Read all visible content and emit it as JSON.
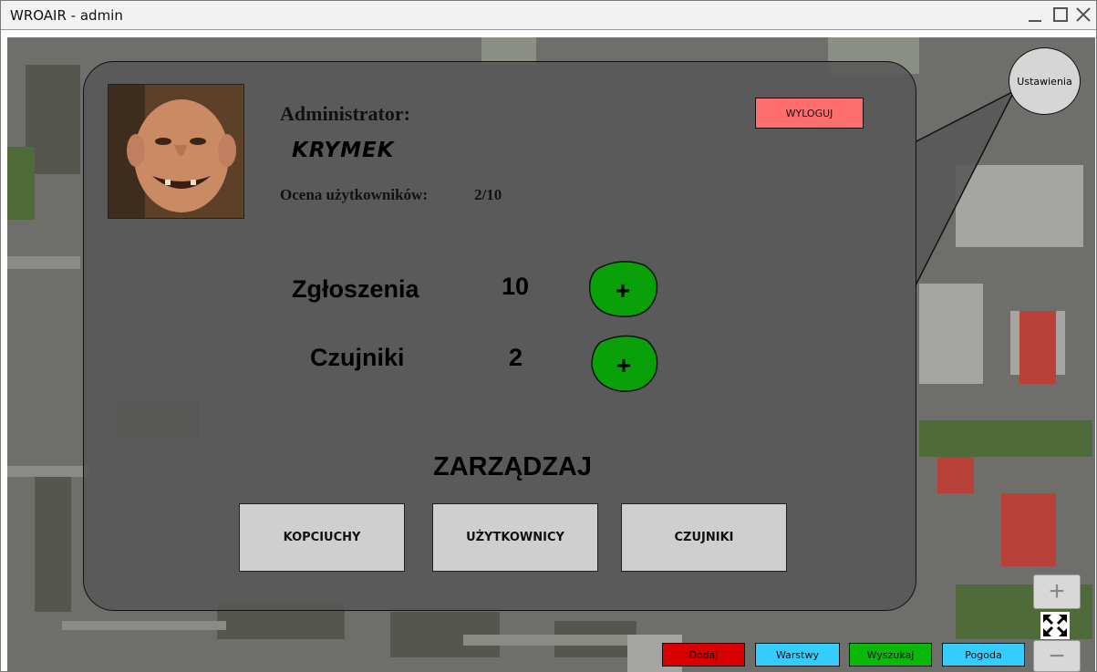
{
  "window": {
    "title": "WROAIR - admin"
  },
  "profile": {
    "role_label": "Administrator:",
    "name": "KRYMEK",
    "rating_label": "Ocena użytkowników:",
    "rating_value": "2/10",
    "logout_label": "WYLOGUJ"
  },
  "stats": [
    {
      "label": "Zgłoszenia",
      "value": "10"
    },
    {
      "label": "Czujniki",
      "value": "2"
    }
  ],
  "add_button_label": "+",
  "manage": {
    "title": "ZARZĄDZAJ",
    "buttons": [
      "KOPCIUCHY",
      "UŻYTKOWNICY",
      "CZUJNIKI"
    ]
  },
  "settings_label": "Ustawienia",
  "zoom": {
    "in_label": "+",
    "out_label": "−"
  },
  "toolbar": [
    {
      "label": "Dodaj",
      "color": "#d90000"
    },
    {
      "label": "Warstwy",
      "color": "#35ccff"
    },
    {
      "label": "Wyszukaj",
      "color": "#0ab80a"
    },
    {
      "label": "Pogoda",
      "color": "#35ccff"
    }
  ],
  "colors": {
    "logout": "#ff6e6e",
    "add_button": "#0aa00a",
    "manage_button": "#cfcfcf",
    "panel": "#585858"
  }
}
